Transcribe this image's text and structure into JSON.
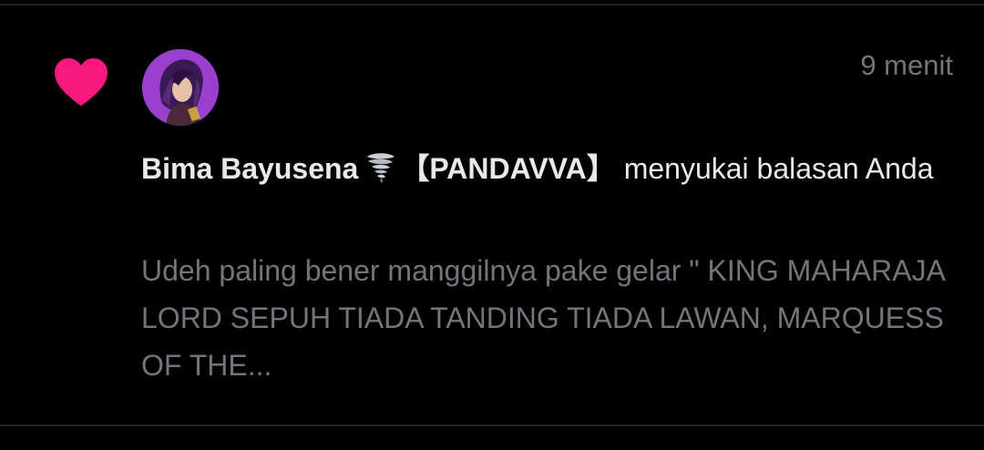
{
  "notification": {
    "icon": "heart-icon",
    "icon_color": "#f91880",
    "timestamp": "9 menit",
    "user": {
      "display_name": "Bima Bayusena",
      "name_emoji": "tornado-emoji",
      "name_tag": "【PANDAVVA】",
      "avatar": "avatar"
    },
    "action_text": "menyukai balasan Anda",
    "reply_preview": "Udeh paling bener manggilnya pake gelar \" KING MAHARAJA LORD SEPUH TIADA TANDING TIADA LAWAN, MARQUESS OF THE..."
  },
  "colors": {
    "background": "#000000",
    "primary_text": "#e7e9ea",
    "secondary_text": "#71767b",
    "divider": "#1f2327",
    "avatar_bg": "#9b3fd0"
  }
}
